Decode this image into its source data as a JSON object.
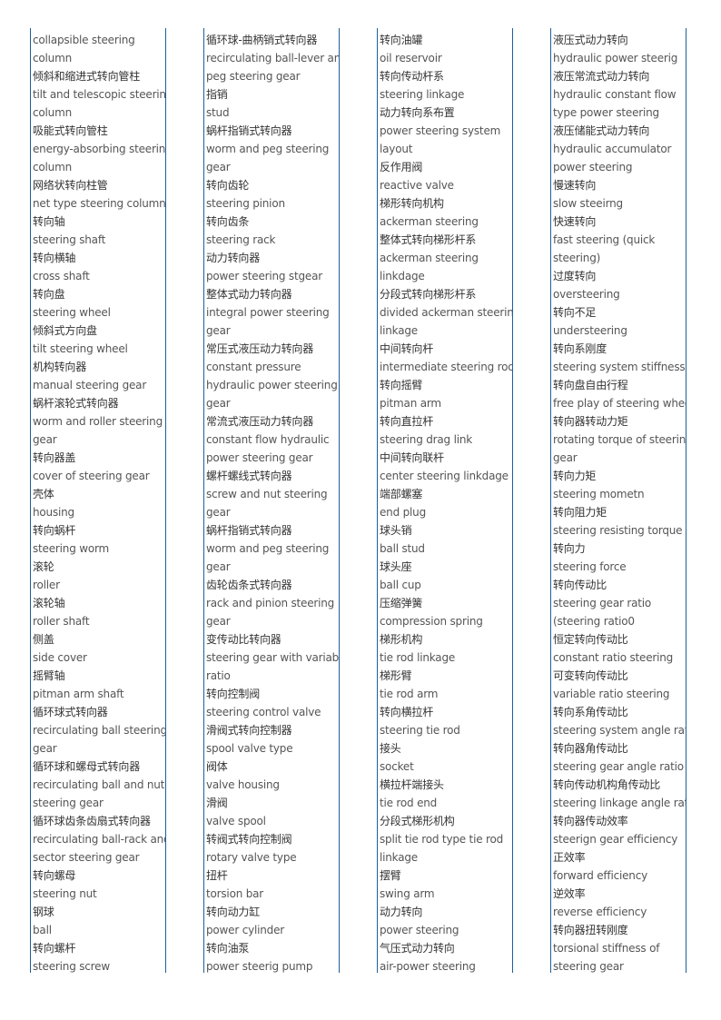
{
  "colors": {
    "rule": "#1f5f99",
    "english_text": "#555555",
    "chinese_text": "#333333"
  },
  "columns": [
    {
      "lines": [
        "collapsible steering",
        "column",
        "倾斜和缩进式转向管柱",
        "tilt and telescopic steering",
        "column",
        "吸能式转向管柱",
        "energy-absorbing steering",
        "column",
        "网络状转向柱管",
        "net type steering column",
        "转向轴",
        "steering shaft",
        "转向横轴",
        "cross shaft",
        "转向盘",
        "steering wheel",
        "倾斜式方向盘",
        "tilt steering wheel",
        "机构转向器",
        "manual steering gear",
        "蜗杆滚轮式转向器",
        "worm and roller steering",
        "gear",
        "转向器盖",
        "cover of steering gear",
        "壳体",
        "housing",
        "转向蜗杆",
        "steering worm",
        "滚轮",
        "roller",
        "滚轮轴",
        "roller shaft",
        "侧盖",
        "side cover",
        "摇臂轴",
        "pitman arm shaft",
        "循环球式转向器",
        "recirculating ball steering",
        "gear",
        "循环球和螺母式转向器",
        "recirculating ball and nut",
        "steering gear",
        "循环球齿条齿扇式转向器",
        "recirculating ball-rack and",
        "sector steering gear",
        "转向螺母",
        "steering nut",
        "钢球",
        "ball",
        "转向螺杆",
        "steering screw"
      ]
    },
    {
      "lines": [
        "循环球-曲柄销式转向器",
        "recirculating ball-lever and",
        "peg steering gear",
        "指销",
        "stud",
        "蜗杆指销式转向器",
        "worm and peg steering",
        "gear",
        "转向齿轮",
        "steering pinion",
        "转向齿条",
        "steering rack",
        "动力转向器",
        "power steering stgear",
        "整体式动力转向器",
        "integral power steering",
        "gear",
        "常压式液压动力转向器",
        "constant pressure",
        "hydraulic power steering",
        "gear",
        "常流式液压动力转向器",
        "constant flow hydraulic",
        "power steering gear",
        "螺杆螺线式转向器",
        "screw and nut steering",
        "gear",
        "蜗杆指销式转向器",
        "worm and peg steering",
        "gear",
        "齿轮齿条式转向器",
        "rack and pinion steering",
        "gear",
        "变传动比转向器",
        "steering gear with variable",
        "ratio",
        "转向控制阀",
        "steering control valve",
        "滑阀式转向控制器",
        "spool valve type",
        "阀体",
        "valve housing",
        "滑阀",
        "valve spool",
        "转阀式转向控制阀",
        "rotary valve type",
        "扭杆",
        "torsion bar",
        "转向动力缸",
        "power cylinder",
        "转向油泵",
        "power steerig pump"
      ]
    },
    {
      "lines": [
        "转向油罐",
        "oil reservoir",
        "转向传动杆系",
        "steering linkage",
        "动力转向系布置",
        "power steering system",
        "layout",
        "反作用阀",
        "reactive valve",
        "梯形转向机构",
        "ackerman steering",
        "整体式转向梯形杆系",
        "ackerman steering",
        "linkdage",
        "分段式转向梯形杆系",
        "divided ackerman steering",
        "linkage",
        "中间转向杆",
        "intermediate steering rod",
        "转向摇臂",
        "pitman arm",
        "转向直拉杆",
        "steering drag link",
        "中间转向联杆",
        "center steering linkdage",
        "端部螺塞",
        "end plug",
        "球头销",
        "ball stud",
        "球头座",
        "ball cup",
        "压缩弹簧",
        "compression spring",
        "梯形机构",
        "tie rod linkage",
        "梯形臂",
        "tie rod arm",
        "转向横拉杆",
        "steering tie rod",
        "接头",
        "socket",
        "横拉杆端接头",
        "tie rod end",
        "分段式梯形机构",
        "split tie rod type tie rod",
        "linkage",
        "摆臂",
        "swing arm",
        "动力转向",
        "power steering",
        "气压式动力转向",
        "air-power steering"
      ]
    },
    {
      "lines": [
        "液压式动力转向",
        "hydraulic power steerig",
        "液压常流式动力转向",
        "hydraulic constant flow",
        "type power steering",
        "液压储能式动力转向",
        "hydraulic accumulator",
        "power steering",
        "慢速转向",
        "slow steeirng",
        "快速转向",
        "fast steering (quick",
        "steering)",
        "过度转向",
        "oversteering",
        "转向不足",
        "understeering",
        "转向系刚度",
        "steering system stiffness",
        "转向盘自由行程",
        "free play of steering wheel",
        "转向器转动力矩",
        "rotating torque of steering",
        "gear",
        "转向力矩",
        "steering mometn",
        "转向阻力矩",
        "steering resisting torque",
        "转向力",
        "steering force",
        "转向传动比",
        "steering gear ratio",
        "(steering ratio0",
        "恒定转向传动比",
        "constant ratio steering",
        "可变转向传动比",
        "variable ratio steering",
        "转向系角传动比",
        "steering system angle ratio",
        "转向器角传动比",
        "steering gear angle ratio",
        "转向传动机构角传动比",
        "steering linkage angle ratio",
        "转向器传动效率",
        "steerign gear efficiency",
        "正效率",
        "forward efficiency",
        "逆效率",
        "reverse efficiency",
        "转向器扭转刚度",
        "torsional stiffness of",
        "steering gear"
      ]
    }
  ]
}
